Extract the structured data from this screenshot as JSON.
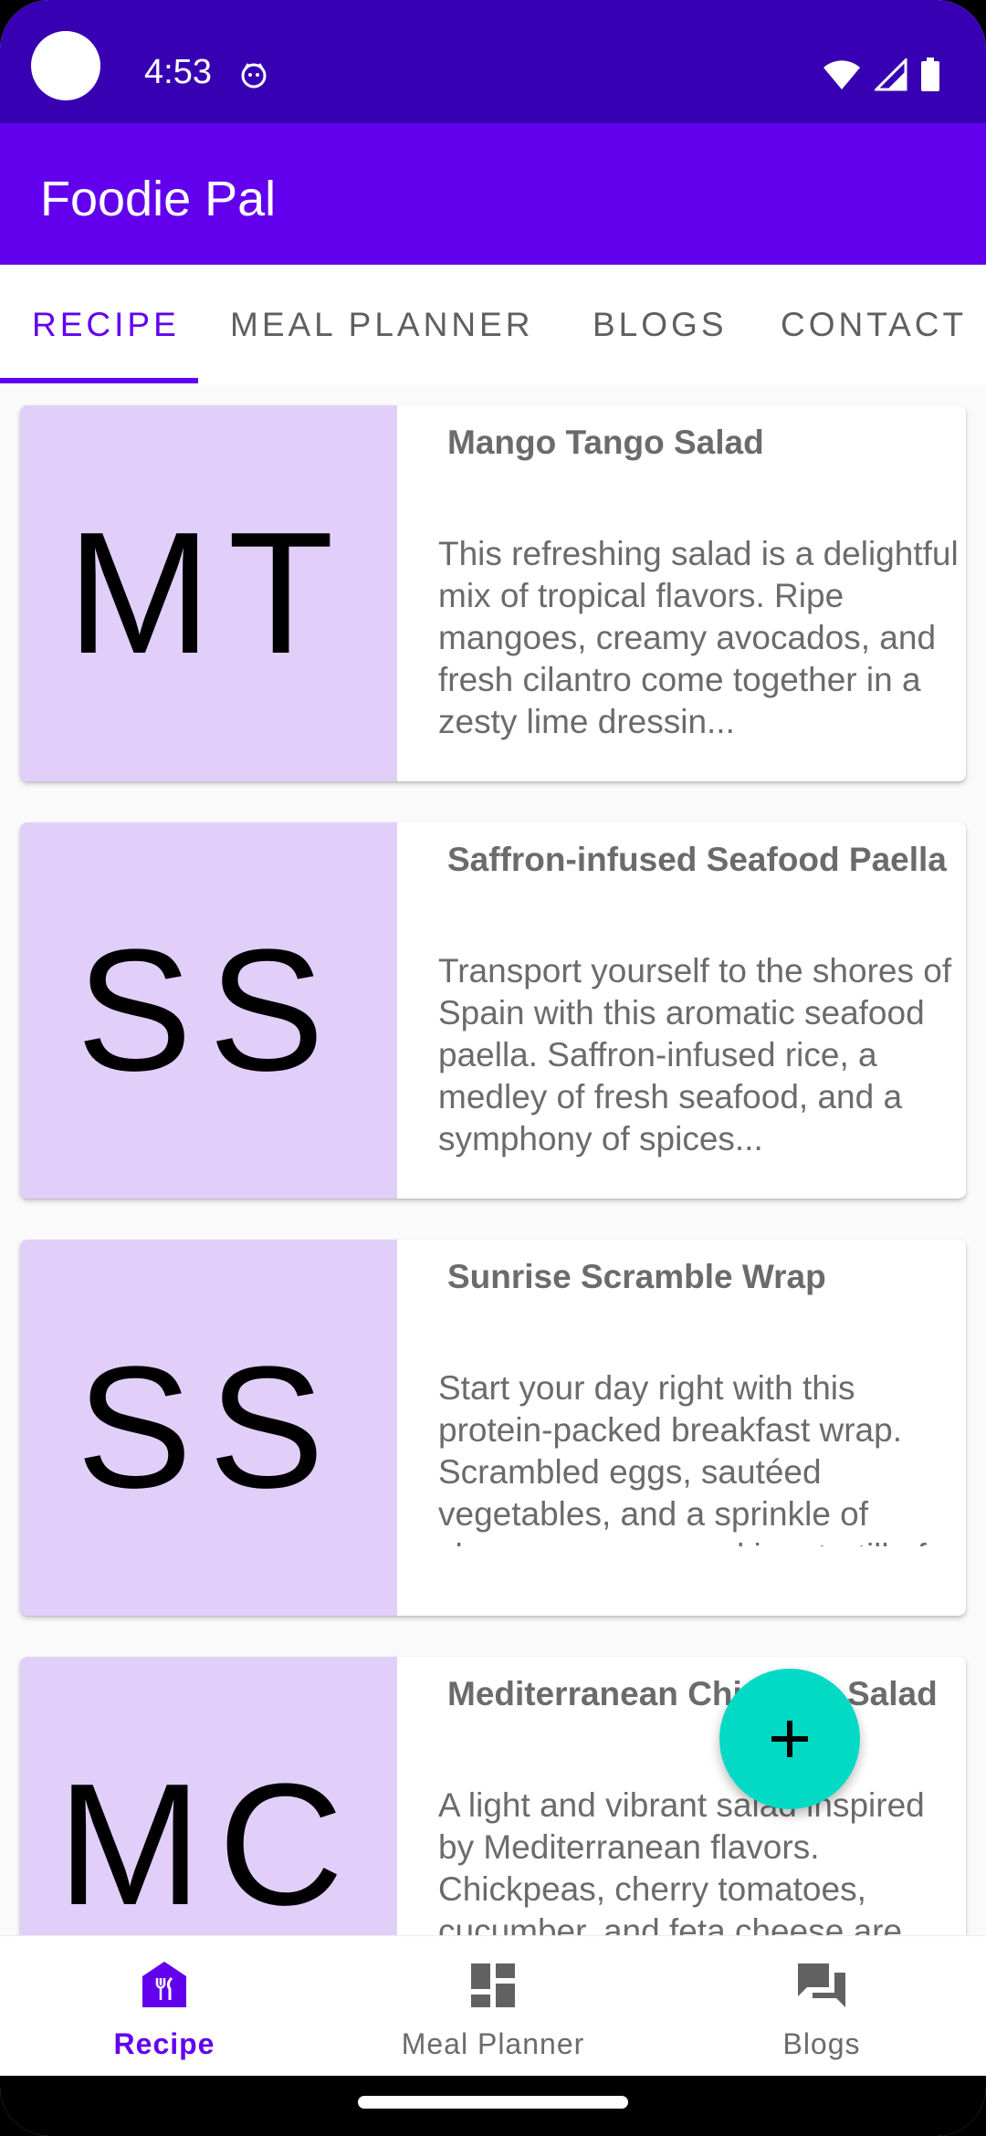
{
  "status_bar": {
    "time": "4:53",
    "icons": [
      "wifi-icon",
      "cellular-signal-icon",
      "battery-icon"
    ]
  },
  "app_bar": {
    "title": "Foodie Pal"
  },
  "tabs": [
    {
      "label": "RECIPE",
      "active": true
    },
    {
      "label": "MEAL PLANNER",
      "active": false
    },
    {
      "label": "BLOGS",
      "active": false
    },
    {
      "label": "CONTACT",
      "active": false
    }
  ],
  "recipes": [
    {
      "initials": "MT",
      "title": "Mango Tango Salad",
      "description": "This refreshing salad is a delightful mix of tropical flavors. Ripe mangoes, creamy avocados, and fresh cilantro come together in a zesty lime dressin..."
    },
    {
      "initials": "SS",
      "title": "Saffron-infused Seafood Paella",
      "description": "Transport yourself to the shores of Spain with this aromatic seafood paella. Saffron-infused rice, a medley of fresh seafood, and a symphony of spices..."
    },
    {
      "initials": "SS",
      "title": "Sunrise Scramble Wrap",
      "description": "Start your day right with this protein-packed breakfast wrap. Scrambled eggs, sautéed vegetables, and a sprinkle of cheese are wrapped in a tortilla f..."
    },
    {
      "initials": "MC",
      "title": "Mediterranean Chickpea Salad",
      "description": "A light and vibrant salad inspired by Mediterranean flavors. Chickpeas, cherry tomatoes, cucumber, and feta cheese are tossed in a lemon-herb dressing..."
    }
  ],
  "fab": {
    "icon": "add-icon"
  },
  "bottom_nav": [
    {
      "label": "Recipe",
      "icon": "restaurant-icon",
      "active": true
    },
    {
      "label": "Meal Planner",
      "icon": "dashboard-icon",
      "active": false
    },
    {
      "label": "Blogs",
      "icon": "forum-icon",
      "active": false
    }
  ],
  "colors": {
    "status_bar": "#3700B3",
    "primary": "#6200EE",
    "accent": "#03DAC5",
    "thumbnail_bg": "#E1CFFA"
  }
}
